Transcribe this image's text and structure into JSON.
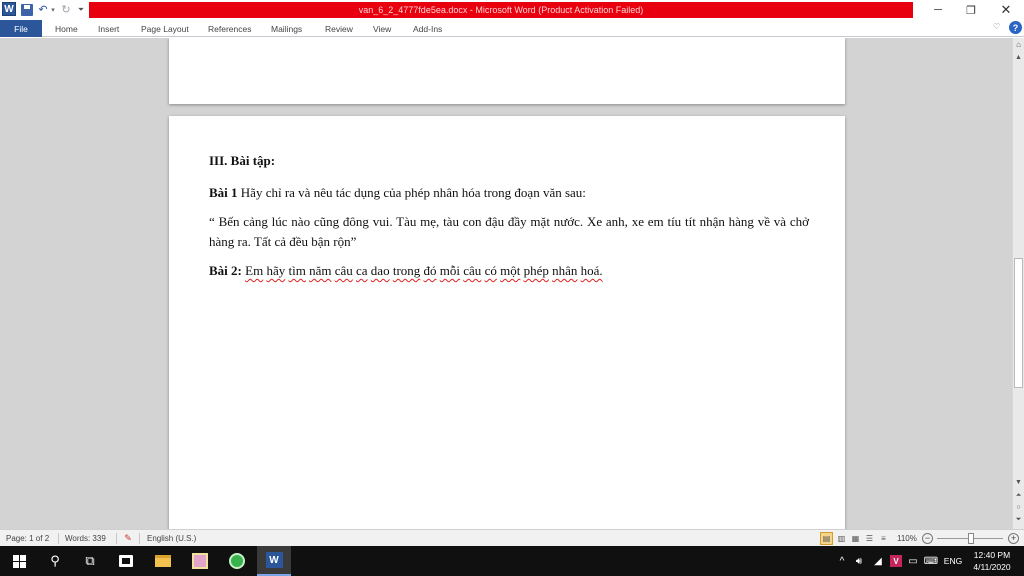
{
  "titlebar": {
    "app_icon": "word-logo-icon",
    "app_letter": "W",
    "title": "van_6_2_4777fde5ea.docx - Microsoft Word (Product Activation Failed)",
    "banner_color": "#e8000e",
    "quick_access": [
      "save-icon",
      "undo-icon",
      "redo-icon",
      "customize-quick-access-icon"
    ],
    "window_controls": {
      "minimize": "─",
      "restore": "❐",
      "close": "✕"
    }
  },
  "ribbon": {
    "tabs": [
      {
        "id": "file",
        "label": "File",
        "active": true
      },
      {
        "id": "home",
        "label": "Home"
      },
      {
        "id": "insert",
        "label": "Insert"
      },
      {
        "id": "page-layout",
        "label": "Page Layout"
      },
      {
        "id": "references",
        "label": "References"
      },
      {
        "id": "mailings",
        "label": "Mailings"
      },
      {
        "id": "review",
        "label": "Review"
      },
      {
        "id": "view",
        "label": "View"
      },
      {
        "id": "add-ins",
        "label": "Add-Ins"
      }
    ],
    "help_label": "?",
    "accent_color": "#2b579a"
  },
  "document": {
    "heading": "III. Bài tập:",
    "bai1": {
      "label": "Bài 1",
      "text": " Hãy chỉ ra và nêu tác dụng của phép nhân hóa trong đoạn văn sau:"
    },
    "quote": "“ Bến cảng lúc nào cũng đông vui. Tàu mẹ, tàu con đậu đầy mặt nước. Xe anh, xe em tíu tít nhận hàng về và chở hàng ra. Tất cả đều bận rộn”",
    "bai2": {
      "label": "Bài 2:",
      "words": [
        "Em",
        "hãy",
        "tìm",
        "năm",
        "câu",
        "ca",
        "dao",
        "trong",
        "đó",
        "mỗi",
        "câu",
        "có",
        "một",
        "phép",
        "nhân",
        "hoá."
      ]
    }
  },
  "statusbar": {
    "page": "Page: 1 of 2",
    "words": "Words: 339",
    "proofing_icon": "proofing-errors-icon",
    "language": "English (U.S.)",
    "zoom": "110%",
    "view_buttons": [
      "print-layout-icon",
      "full-screen-reading-icon",
      "web-layout-icon",
      "outline-icon",
      "draft-icon"
    ]
  },
  "taskbar": {
    "apps": [
      "start-icon",
      "search-icon",
      "task-view-icon",
      "store-icon",
      "file-explorer-icon",
      "game-app-icon",
      "green-app-icon",
      "word-app-icon"
    ],
    "tray": {
      "chevron": "^",
      "language": "ENG"
    },
    "clock": {
      "time": "12:40 PM",
      "date": "4/11/2020"
    }
  }
}
